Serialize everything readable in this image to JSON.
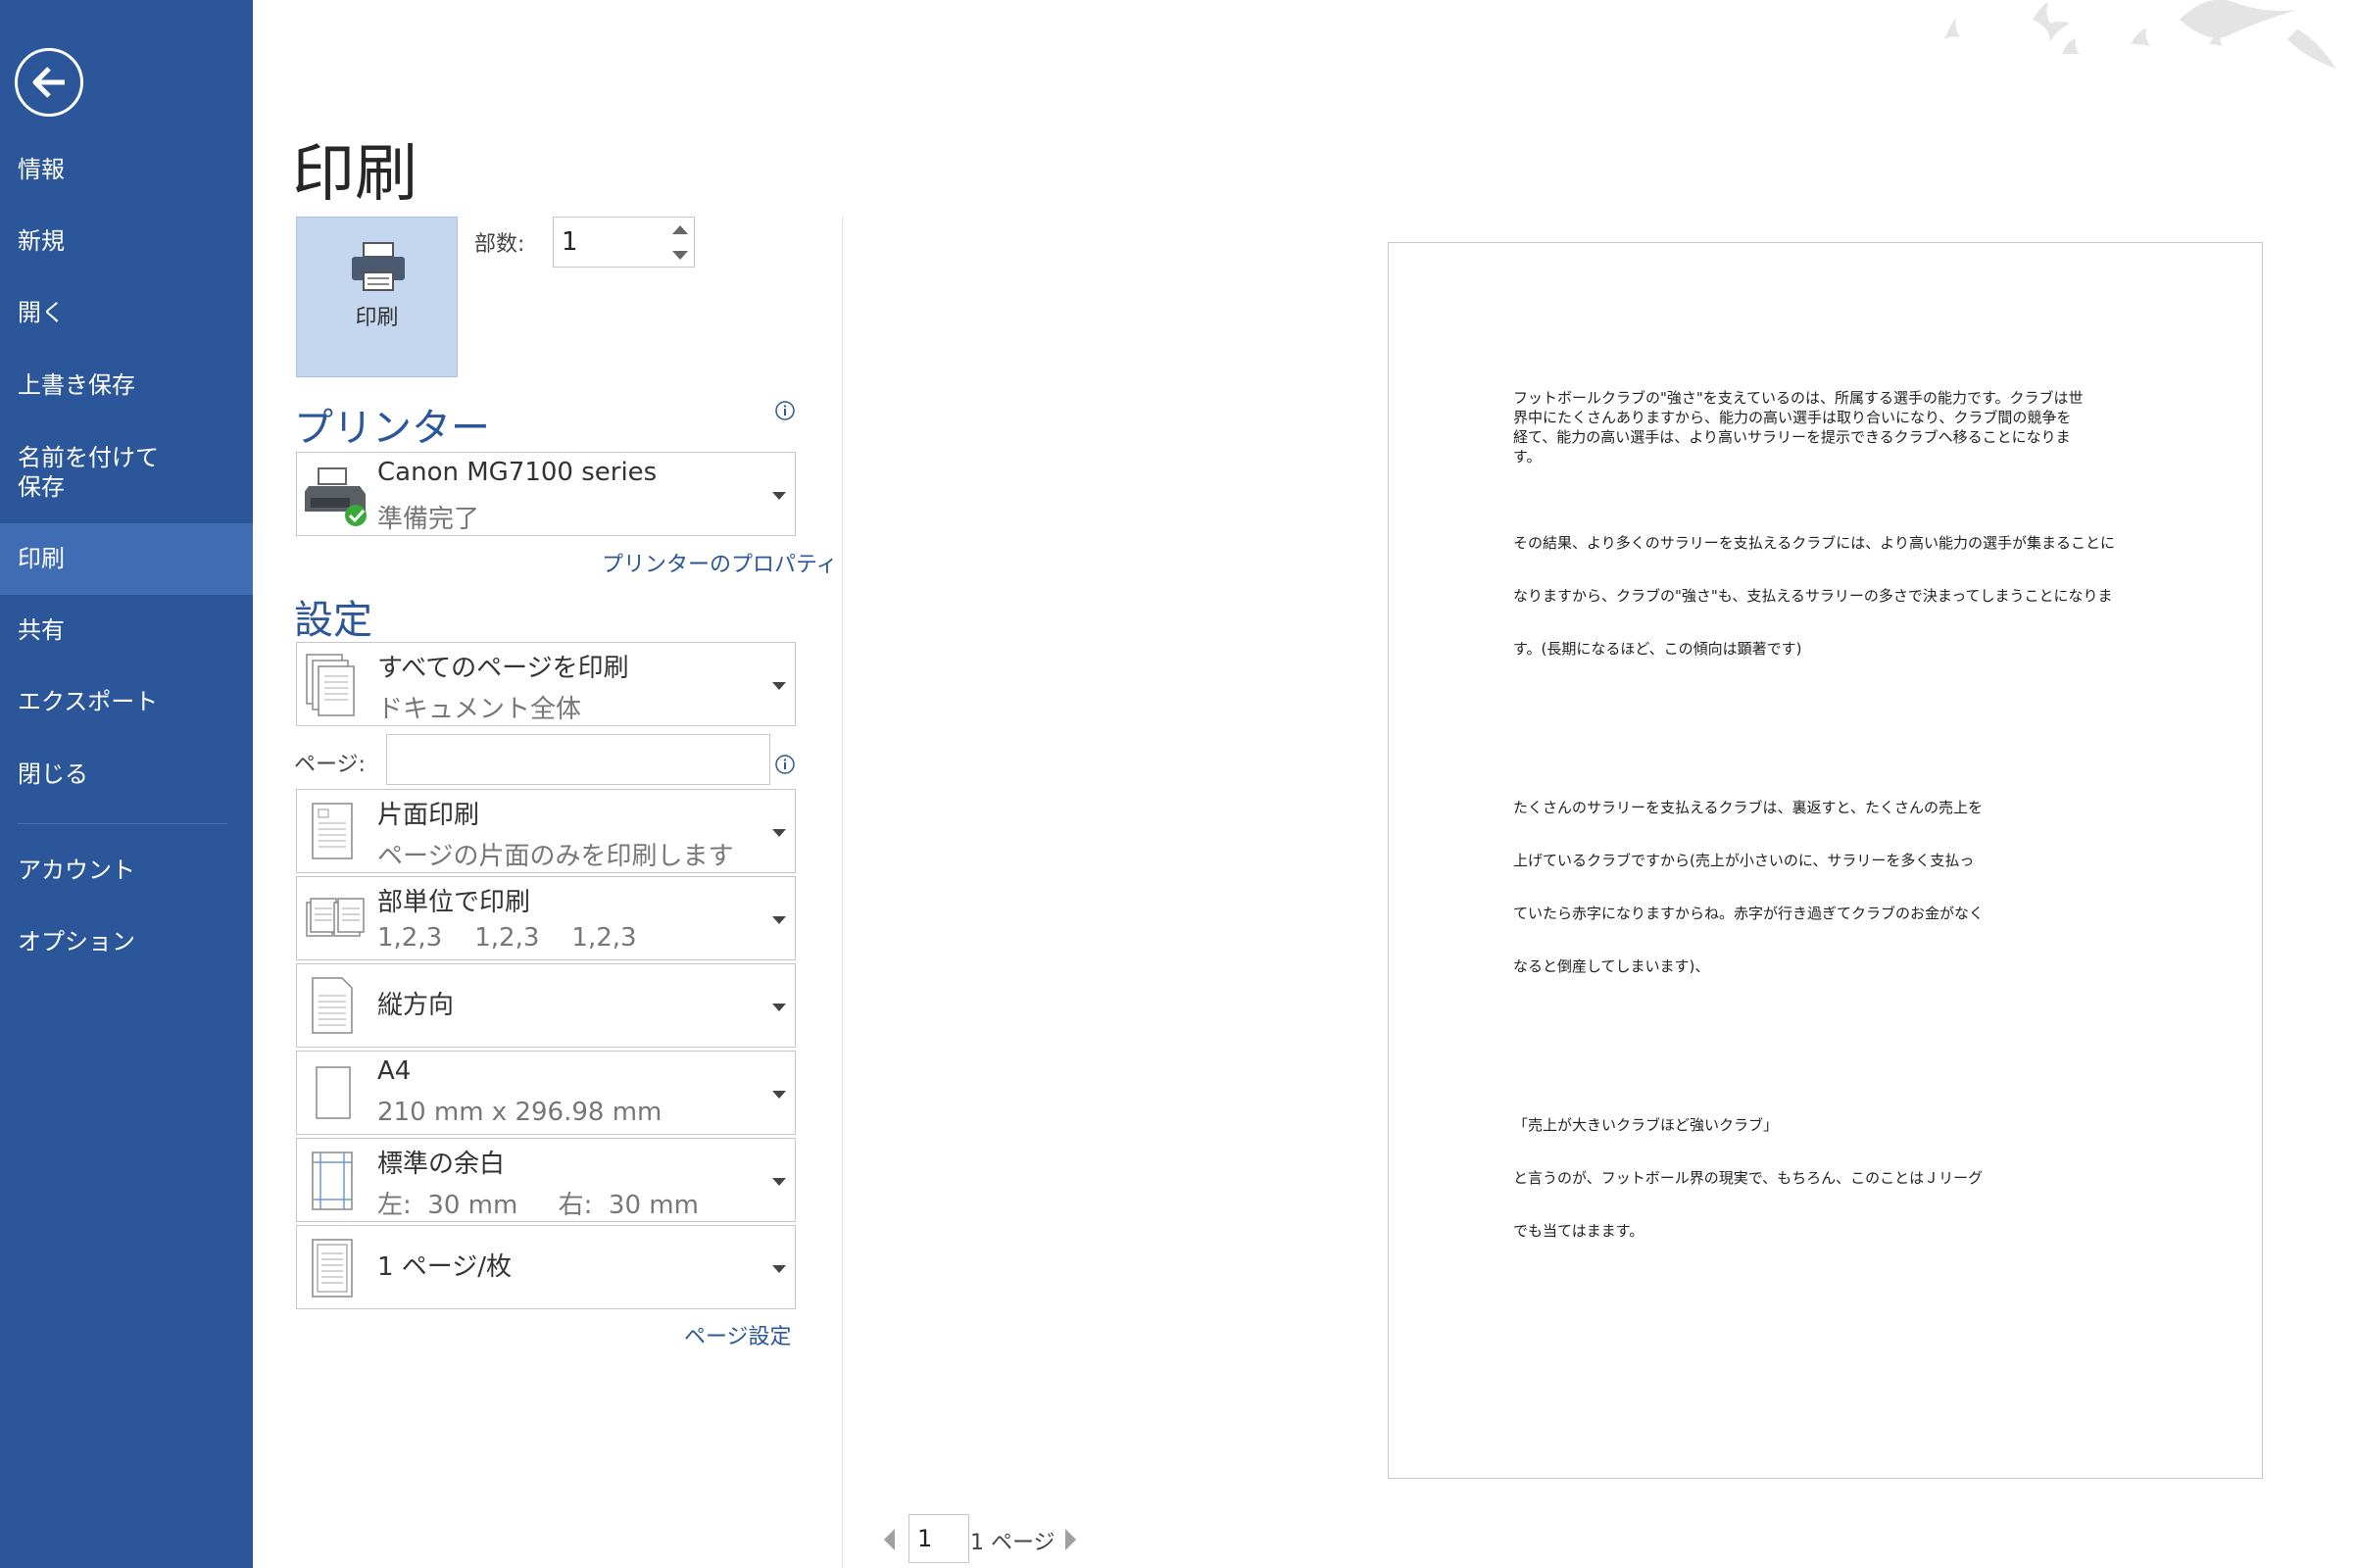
{
  "sidebar": {
    "items": [
      {
        "label": "情報"
      },
      {
        "label": "新規"
      },
      {
        "label": "開く"
      },
      {
        "label": "上書き保存"
      },
      {
        "label": "名前を付けて\n保存"
      },
      {
        "label": "印刷"
      },
      {
        "label": "共有"
      },
      {
        "label": "エクスポート"
      },
      {
        "label": "閉じる"
      },
      {
        "label": "アカウント"
      },
      {
        "label": "オプション"
      }
    ],
    "active_index": 5,
    "bg_color": "#2b579a"
  },
  "main": {
    "title": "印刷",
    "print_button_label": "印刷",
    "copies_label": "部数:",
    "copies_value": "1",
    "printer_heading": "プリンター",
    "printer_name": "Canon MG7100 series",
    "printer_status": "準備完了",
    "printer_properties_link": "プリンターのプロパティ",
    "settings_heading": "設定",
    "settings": {
      "range_title": "すべてのページを印刷",
      "range_sub": "ドキュメント全体",
      "pages_label": "ページ:",
      "pages_value": "",
      "sides_title": "片面印刷",
      "sides_sub": "ページの片面のみを印刷します",
      "collate_title": "部単位で印刷",
      "collate_sub": "1,2,3    1,2,3    1,2,3",
      "orientation_title": "縦方向",
      "paper_title": "A4",
      "paper_sub": "210 mm x 296.98 mm",
      "margins_title": "標準の余白",
      "margins_sub": "左:  30 mm     右:  30 mm",
      "per_sheet_title": "1 ページ/枚"
    },
    "page_setup_link": "ページ設定"
  },
  "preview": {
    "lines": [
      "フットボールクラブの\"強さ\"を支えているのは、所属する選手の能力です。クラブは世",
      "界中にたくさんありますから、能力の高い選手は取り合いになり、クラブ間の競争を",
      "経て、能力の高い選手は、より高いサラリーを提示できるクラブへ移ることになりま",
      "す。",
      "その結果、より多くのサラリーを支払えるクラブには、より高い能力の選手が集まることに",
      "なりますから、クラブの\"強さ\"も、支払えるサラリーの多さで決まってしまうことになりま",
      "す。(長期になるほど、この傾向は顕著です)",
      "たくさんのサラリーを支払えるクラブは、裏返すと、たくさんの売上を",
      "上げているクラブですから(売上が小さいのに、サラリーを多く支払っ",
      "ていたら赤字になりますからね。赤字が行き過ぎてクラブのお金がなく",
      "なると倒産してしまいます)、",
      "「売上が大きいクラブほど強いクラブ」",
      "と言うのが、フットボール界の現実で、もちろん、このことはＪリーグ",
      "でも当てはまます。"
    ]
  },
  "pager": {
    "current": "1",
    "total_label": "1 ページ"
  }
}
